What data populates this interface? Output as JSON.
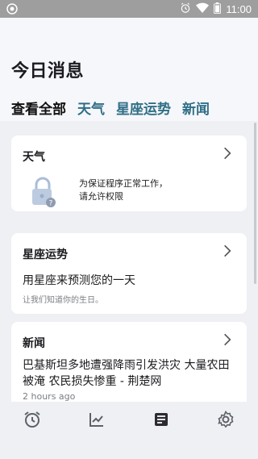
{
  "status_bar": {
    "time": "11:00",
    "left_icon": "notification-dot-icon",
    "icons": [
      "alarm-icon",
      "wifi-icon",
      "battery-icon"
    ]
  },
  "header": {
    "title": "今日消息",
    "tabs": [
      {
        "label": "查看全部",
        "active": true
      },
      {
        "label": "天气",
        "active": false
      },
      {
        "label": "星座运势",
        "active": false
      },
      {
        "label": "新闻",
        "active": false
      }
    ]
  },
  "cards": {
    "weather": {
      "title": "天气",
      "message": "为保证程序正常工作，请允许权限"
    },
    "astrology": {
      "title": "星座运势",
      "headline": "用星座来预测您的一天",
      "hint": "让我们知道你的生日。"
    },
    "news": {
      "title": "新闻",
      "headline": "巴基斯坦多地遭强降雨引发洪灾 大量农田被淹 农民损失惨重 - 荆楚网",
      "time": "2 hours ago"
    }
  },
  "bottom_nav": {
    "items": [
      "alarm-clock-icon",
      "chart-icon",
      "news-icon",
      "settings-icon"
    ],
    "active": "news-icon"
  },
  "colors": {
    "accent": "#2a9ec5",
    "tab_inactive": "#2f6f86",
    "background": "#eef0f4"
  }
}
